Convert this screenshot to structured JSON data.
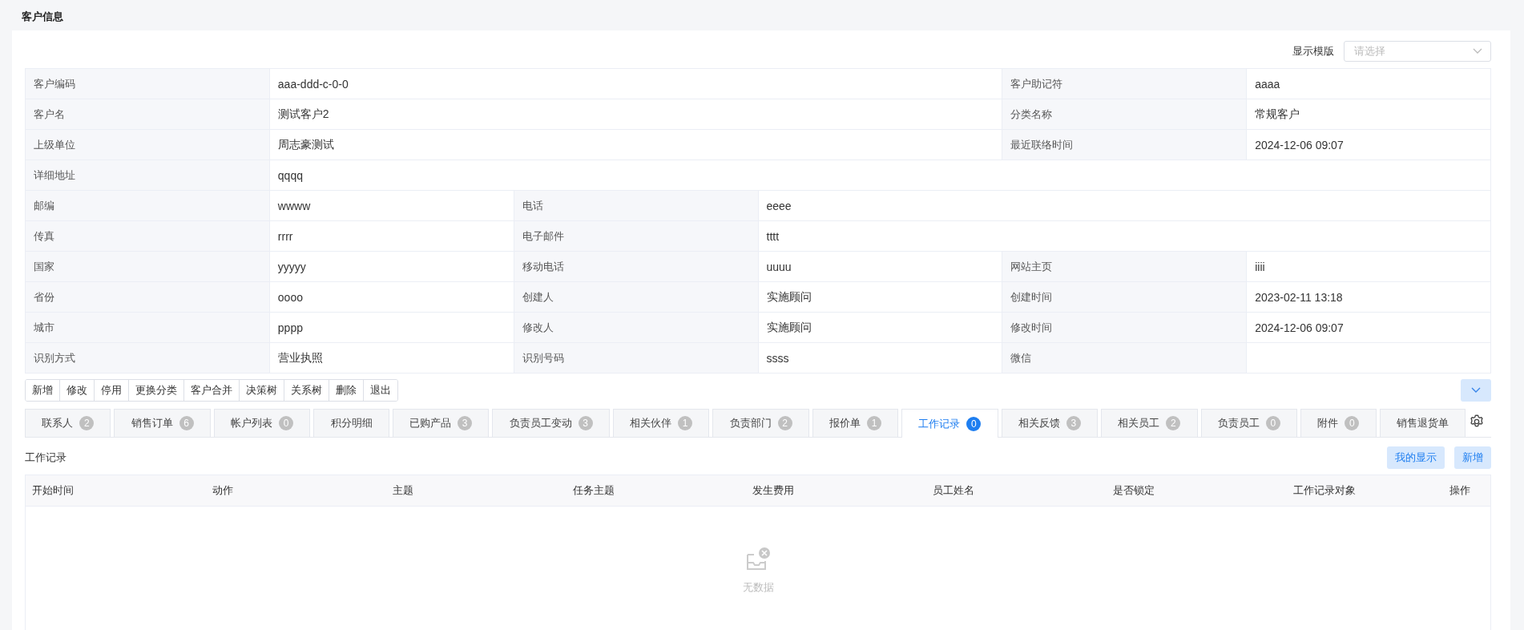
{
  "page_title": "客户信息",
  "template": {
    "label": "显示模版",
    "placeholder": "请选择"
  },
  "info_rows": [
    [
      {
        "kind": "label",
        "text": "客户编码"
      },
      {
        "kind": "value_wide",
        "text": "aaa-ddd-c-0-0"
      },
      {
        "kind": "label",
        "text": "客户助记符"
      },
      {
        "kind": "value",
        "text": "aaaa"
      }
    ],
    [
      {
        "kind": "label",
        "text": "客户名"
      },
      {
        "kind": "value_wide",
        "text": "测试客户2"
      },
      {
        "kind": "label",
        "text": "分类名称"
      },
      {
        "kind": "value",
        "text": "常规客户"
      }
    ],
    [
      {
        "kind": "label",
        "text": "上级单位"
      },
      {
        "kind": "value_wide",
        "text": "周志豪测试"
      },
      {
        "kind": "label",
        "text": "最近联络时间"
      },
      {
        "kind": "value",
        "text": "2024-12-06 09:07"
      }
    ],
    [
      {
        "kind": "label",
        "text": "详细地址"
      },
      {
        "kind": "value_full",
        "text": "qqqq"
      }
    ],
    [
      {
        "kind": "label",
        "text": "邮编"
      },
      {
        "kind": "value",
        "text": "wwww"
      },
      {
        "kind": "label",
        "text": "电话"
      },
      {
        "kind": "value_wide",
        "text": "eeee"
      }
    ],
    [
      {
        "kind": "label",
        "text": "传真"
      },
      {
        "kind": "value",
        "text": "rrrr"
      },
      {
        "kind": "label",
        "text": "电子邮件"
      },
      {
        "kind": "value_wide",
        "text": "tttt"
      }
    ],
    [
      {
        "kind": "label",
        "text": "国家"
      },
      {
        "kind": "value",
        "text": "yyyyy"
      },
      {
        "kind": "label",
        "text": "移动电话"
      },
      {
        "kind": "value",
        "text": "uuuu"
      },
      {
        "kind": "label",
        "text": "网站主页"
      },
      {
        "kind": "value",
        "text": "iiii"
      }
    ],
    [
      {
        "kind": "label",
        "text": "省份"
      },
      {
        "kind": "value",
        "text": "oooo"
      },
      {
        "kind": "label",
        "text": "创建人"
      },
      {
        "kind": "value",
        "text": "实施顾问"
      },
      {
        "kind": "label",
        "text": "创建时间"
      },
      {
        "kind": "value",
        "text": "2023-02-11 13:18"
      }
    ],
    [
      {
        "kind": "label",
        "text": "城市"
      },
      {
        "kind": "value",
        "text": "pppp"
      },
      {
        "kind": "label",
        "text": "修改人"
      },
      {
        "kind": "value",
        "text": "实施顾问"
      },
      {
        "kind": "label",
        "text": "修改时间"
      },
      {
        "kind": "value",
        "text": "2024-12-06 09:07"
      }
    ],
    [
      {
        "kind": "label",
        "text": "识别方式"
      },
      {
        "kind": "value",
        "text": "营业执照"
      },
      {
        "kind": "label",
        "text": "识别号码"
      },
      {
        "kind": "value",
        "text": "ssss"
      },
      {
        "kind": "label",
        "text": "微信"
      },
      {
        "kind": "value"
      }
    ]
  ],
  "actions": [
    "新增",
    "修改",
    "停用",
    "更换分类",
    "客户合并",
    "决策树",
    "关系树",
    "删除",
    "退出"
  ],
  "tabs": [
    {
      "label": "联系人",
      "count": "2",
      "selected": false
    },
    {
      "label": "销售订单",
      "count": "6",
      "selected": false
    },
    {
      "label": "帐户列表",
      "count": "0",
      "selected": false
    },
    {
      "label": "积分明细",
      "selected": false
    },
    {
      "label": "已购产品",
      "count": "3",
      "selected": false
    },
    {
      "label": "负责员工变动",
      "count": "3",
      "selected": false
    },
    {
      "label": "相关伙伴",
      "count": "1",
      "selected": false
    },
    {
      "label": "负责部门",
      "count": "2",
      "selected": false
    },
    {
      "label": "报价单",
      "count": "1",
      "selected": false
    },
    {
      "label": "工作记录",
      "count": "0",
      "selected": true
    },
    {
      "label": "相关反馈",
      "count": "3",
      "selected": false
    },
    {
      "label": "相关员工",
      "count": "2",
      "selected": false
    },
    {
      "label": "负责员工",
      "count": "0",
      "selected": false
    },
    {
      "label": "附件",
      "count": "0",
      "selected": false
    },
    {
      "label": "销售退货单",
      "selected": false
    }
  ],
  "section": {
    "title": "工作记录",
    "buttons": [
      "我的显示",
      "新增"
    ]
  },
  "table": {
    "columns": [
      "开始时间",
      "动作",
      "主题",
      "任务主题",
      "发生费用",
      "员工姓名",
      "是否锁定",
      "工作记录对象",
      "操作"
    ],
    "empty_text": "无数据"
  }
}
